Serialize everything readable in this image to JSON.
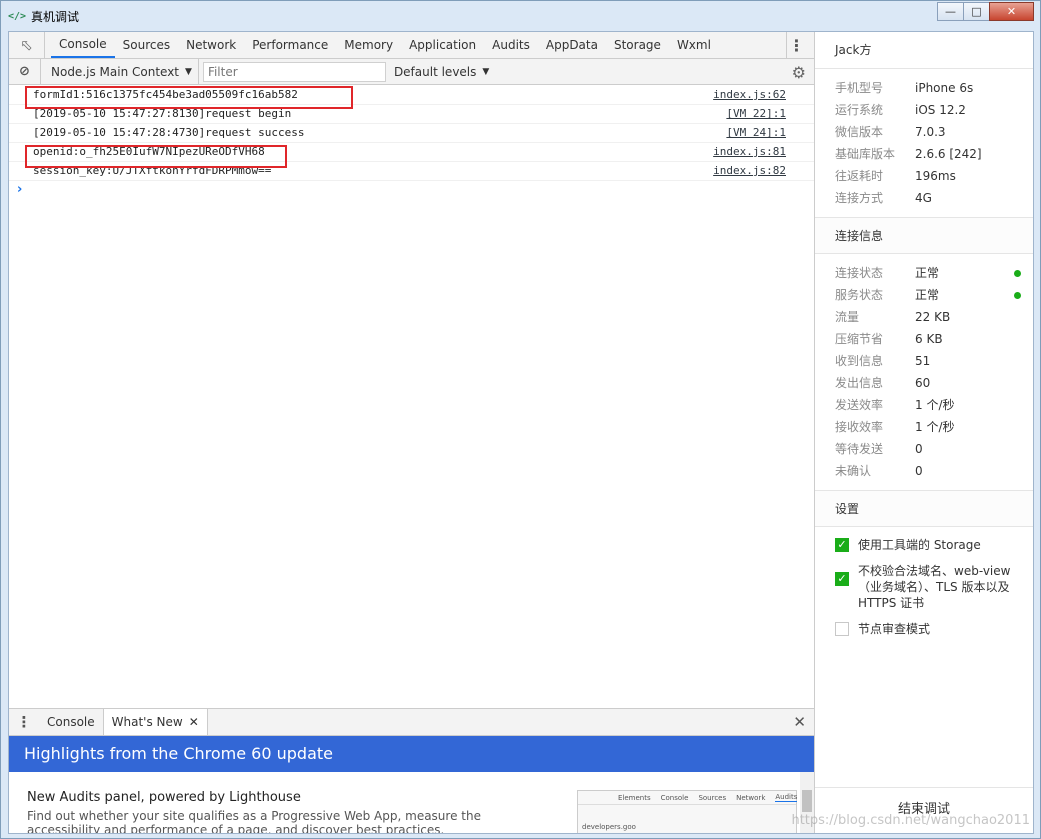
{
  "window": {
    "title": "真机调试",
    "minimize": "0",
    "maximize": "1",
    "close": "r"
  },
  "tabs": [
    "Console",
    "Sources",
    "Network",
    "Performance",
    "Memory",
    "Application",
    "Audits",
    "AppData",
    "Storage",
    "Wxml"
  ],
  "toolbar": {
    "context": "Node.js Main Context",
    "filter_placeholder": "Filter",
    "levels": "Default levels"
  },
  "messages": [
    {
      "text": "formId1:516c1375fc454be3ad05509fc16ab582",
      "source": "index.js:62"
    },
    {
      "text": "[2019-05-10 15:47:27:8130]request begin",
      "source": "[VM 22]:1"
    },
    {
      "text": "[2019-05-10 15:47:28:4730]request success",
      "source": "[VM 24]:1"
    },
    {
      "text": "openid:o_fh25E0IufW7NIpezUReODfVH68",
      "source": "index.js:81"
    },
    {
      "text": "session_key:U/JTXftkonYrfdFDRPMmow==",
      "source": "index.js:82"
    }
  ],
  "drawer": {
    "tab_console": "Console",
    "tab_whatsnew": "What's New"
  },
  "whatsnew": {
    "banner": "Highlights from the Chrome 60 update",
    "title": "New Audits panel, powered by Lighthouse",
    "desc": "Find out whether your site qualifies as a Progressive Web App, measure the accessibility and performance of a page, and discover best practices.",
    "thumb_tabs": [
      "Elements",
      "Console",
      "Sources",
      "Network",
      "Audits"
    ],
    "thumb_url": "developers.goo"
  },
  "panel": {
    "user": "Jack方",
    "device": [
      {
        "k": "手机型号",
        "v": "iPhone 6s"
      },
      {
        "k": "运行系统",
        "v": "iOS 12.2"
      },
      {
        "k": "微信版本",
        "v": "7.0.3"
      },
      {
        "k": "基础库版本",
        "v": "2.6.6 [242]"
      },
      {
        "k": "往返耗时",
        "v": "196ms"
      },
      {
        "k": "连接方式",
        "v": "4G"
      }
    ],
    "conn_title": "连接信息",
    "conn": [
      {
        "k": "连接状态",
        "v": "正常",
        "dot": true
      },
      {
        "k": "服务状态",
        "v": "正常",
        "dot": true
      },
      {
        "k": "流量",
        "v": "22 KB"
      },
      {
        "k": "压缩节省",
        "v": "6 KB"
      },
      {
        "k": "收到信息",
        "v": "51"
      },
      {
        "k": "发出信息",
        "v": "60"
      },
      {
        "k": "发送效率",
        "v": "1 个/秒"
      },
      {
        "k": "接收效率",
        "v": "1 个/秒"
      },
      {
        "k": "等待发送",
        "v": "0"
      },
      {
        "k": "未确认",
        "v": "0"
      }
    ],
    "settings_title": "设置",
    "settings": [
      {
        "label": "使用工具端的 Storage",
        "checked": true
      },
      {
        "label": "不校验合法域名、web-view（业务域名）、TLS 版本以及 HTTPS 证书",
        "checked": true
      },
      {
        "label": "节点审查模式",
        "checked": false
      }
    ],
    "footer": "结束调试",
    "watermark": "https://blog.csdn.net/wangchao2011"
  },
  "colors": {
    "accent": "#1a73e8",
    "banner": "#3367d6",
    "highlight_box": "#e0262a",
    "ok": "#1aad19"
  }
}
